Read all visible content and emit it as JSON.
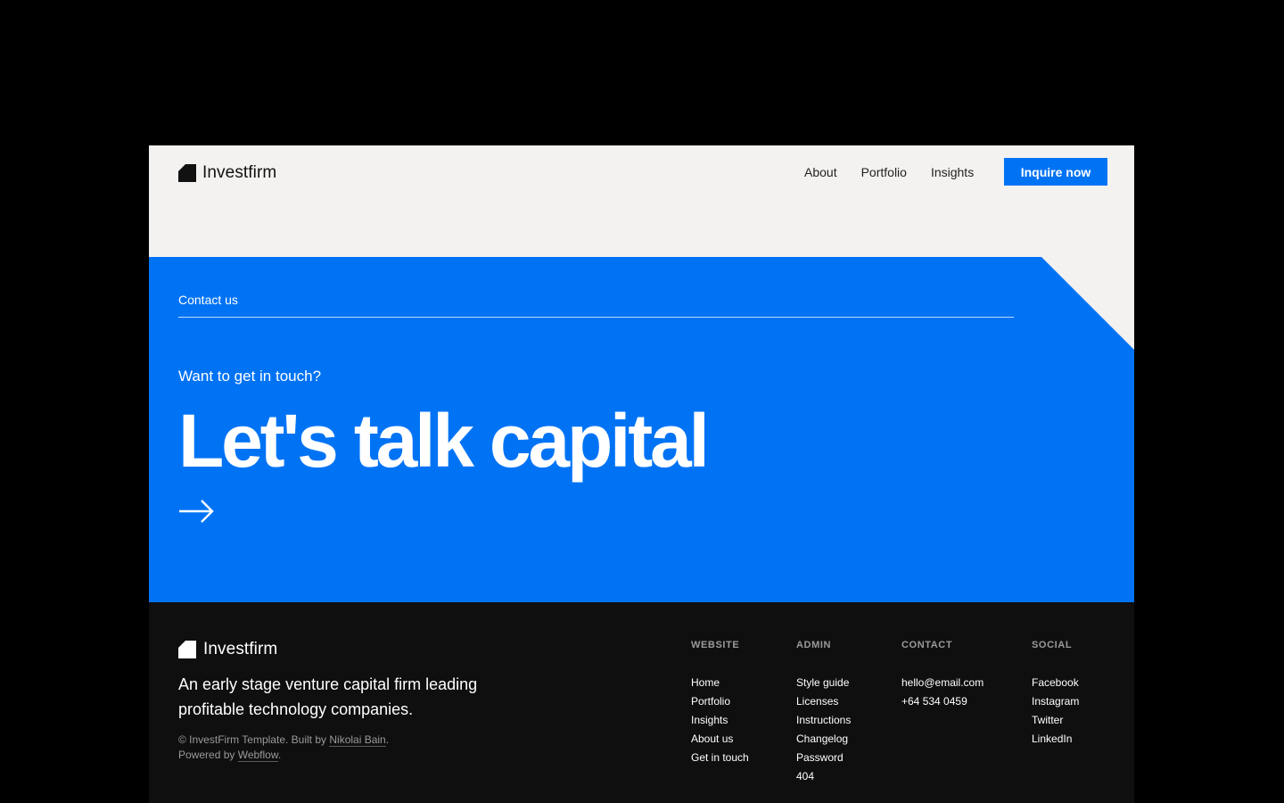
{
  "header": {
    "brand": "Investfirm",
    "nav": [
      {
        "label": "About"
      },
      {
        "label": "Portfolio"
      },
      {
        "label": "Insights"
      }
    ],
    "cta_label": "Inquire now"
  },
  "hero": {
    "section_label": "Contact us",
    "eyebrow": "Want to get in touch?",
    "title": "Let's talk capital",
    "arrow_icon": "arrow-right-icon"
  },
  "footer": {
    "brand": "Investfirm",
    "tagline": "An early stage venture capital firm leading profitable technology companies.",
    "credits": {
      "line1_prefix": "© InvestFirm Template. Built by",
      "author": "Nikolai Bain",
      "line1_suffix": ".",
      "line2_prefix": "Powered by",
      "platform": "Webflow",
      "line2_suffix": "."
    },
    "columns": [
      {
        "heading": "WEBSITE",
        "links": [
          "Home",
          "Portfolio",
          "Insights",
          "About us",
          "Get in touch"
        ]
      },
      {
        "heading": "ADMIN",
        "links": [
          "Style guide",
          "Licenses",
          "Instructions",
          "Changelog",
          "Password",
          "404"
        ]
      },
      {
        "heading": "CONTACT",
        "links": [
          "hello@email.com",
          "+64 534 0459"
        ]
      },
      {
        "heading": "SOCIAL",
        "links": [
          "Facebook",
          "Instagram",
          "Twitter",
          "LinkedIn"
        ]
      }
    ]
  },
  "colors": {
    "page_bg": "#000000",
    "header_bg": "#f4f2f0",
    "accent_blue": "#0073f5",
    "footer_bg": "#100f10",
    "muted_text": "#9a9a9a"
  }
}
